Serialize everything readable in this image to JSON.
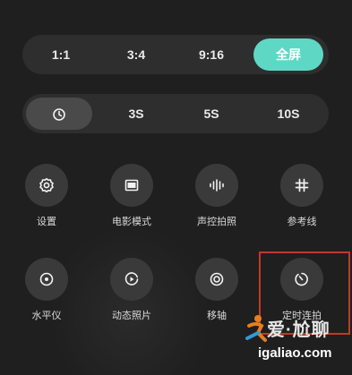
{
  "ratio_options": [
    "1:1",
    "3:4",
    "9:16",
    "全屏"
  ],
  "ratio_selected": "全屏",
  "timer_options": [
    "3S",
    "5S",
    "10S"
  ],
  "timer_selected": "timer-off-icon",
  "tools_row1": [
    {
      "label": "设置",
      "icon": "settings-icon"
    },
    {
      "label": "电影模式",
      "icon": "movie-mode-icon"
    },
    {
      "label": "声控拍照",
      "icon": "voice-shutter-icon"
    },
    {
      "label": "参考线",
      "icon": "grid-lines-icon"
    }
  ],
  "tools_row2": [
    {
      "label": "水平仪",
      "icon": "level-icon"
    },
    {
      "label": "动态照片",
      "icon": "live-photo-icon"
    },
    {
      "label": "移轴",
      "icon": "tilt-shift-icon"
    },
    {
      "label": "定时连拍",
      "icon": "timed-burst-icon"
    }
  ],
  "watermark": {
    "text": "爱·尬聊",
    "url": "igaliao.com"
  },
  "colors": {
    "accent": "#5ed8c4",
    "highlight": "#c0392b",
    "background": "#1f1f1f"
  }
}
